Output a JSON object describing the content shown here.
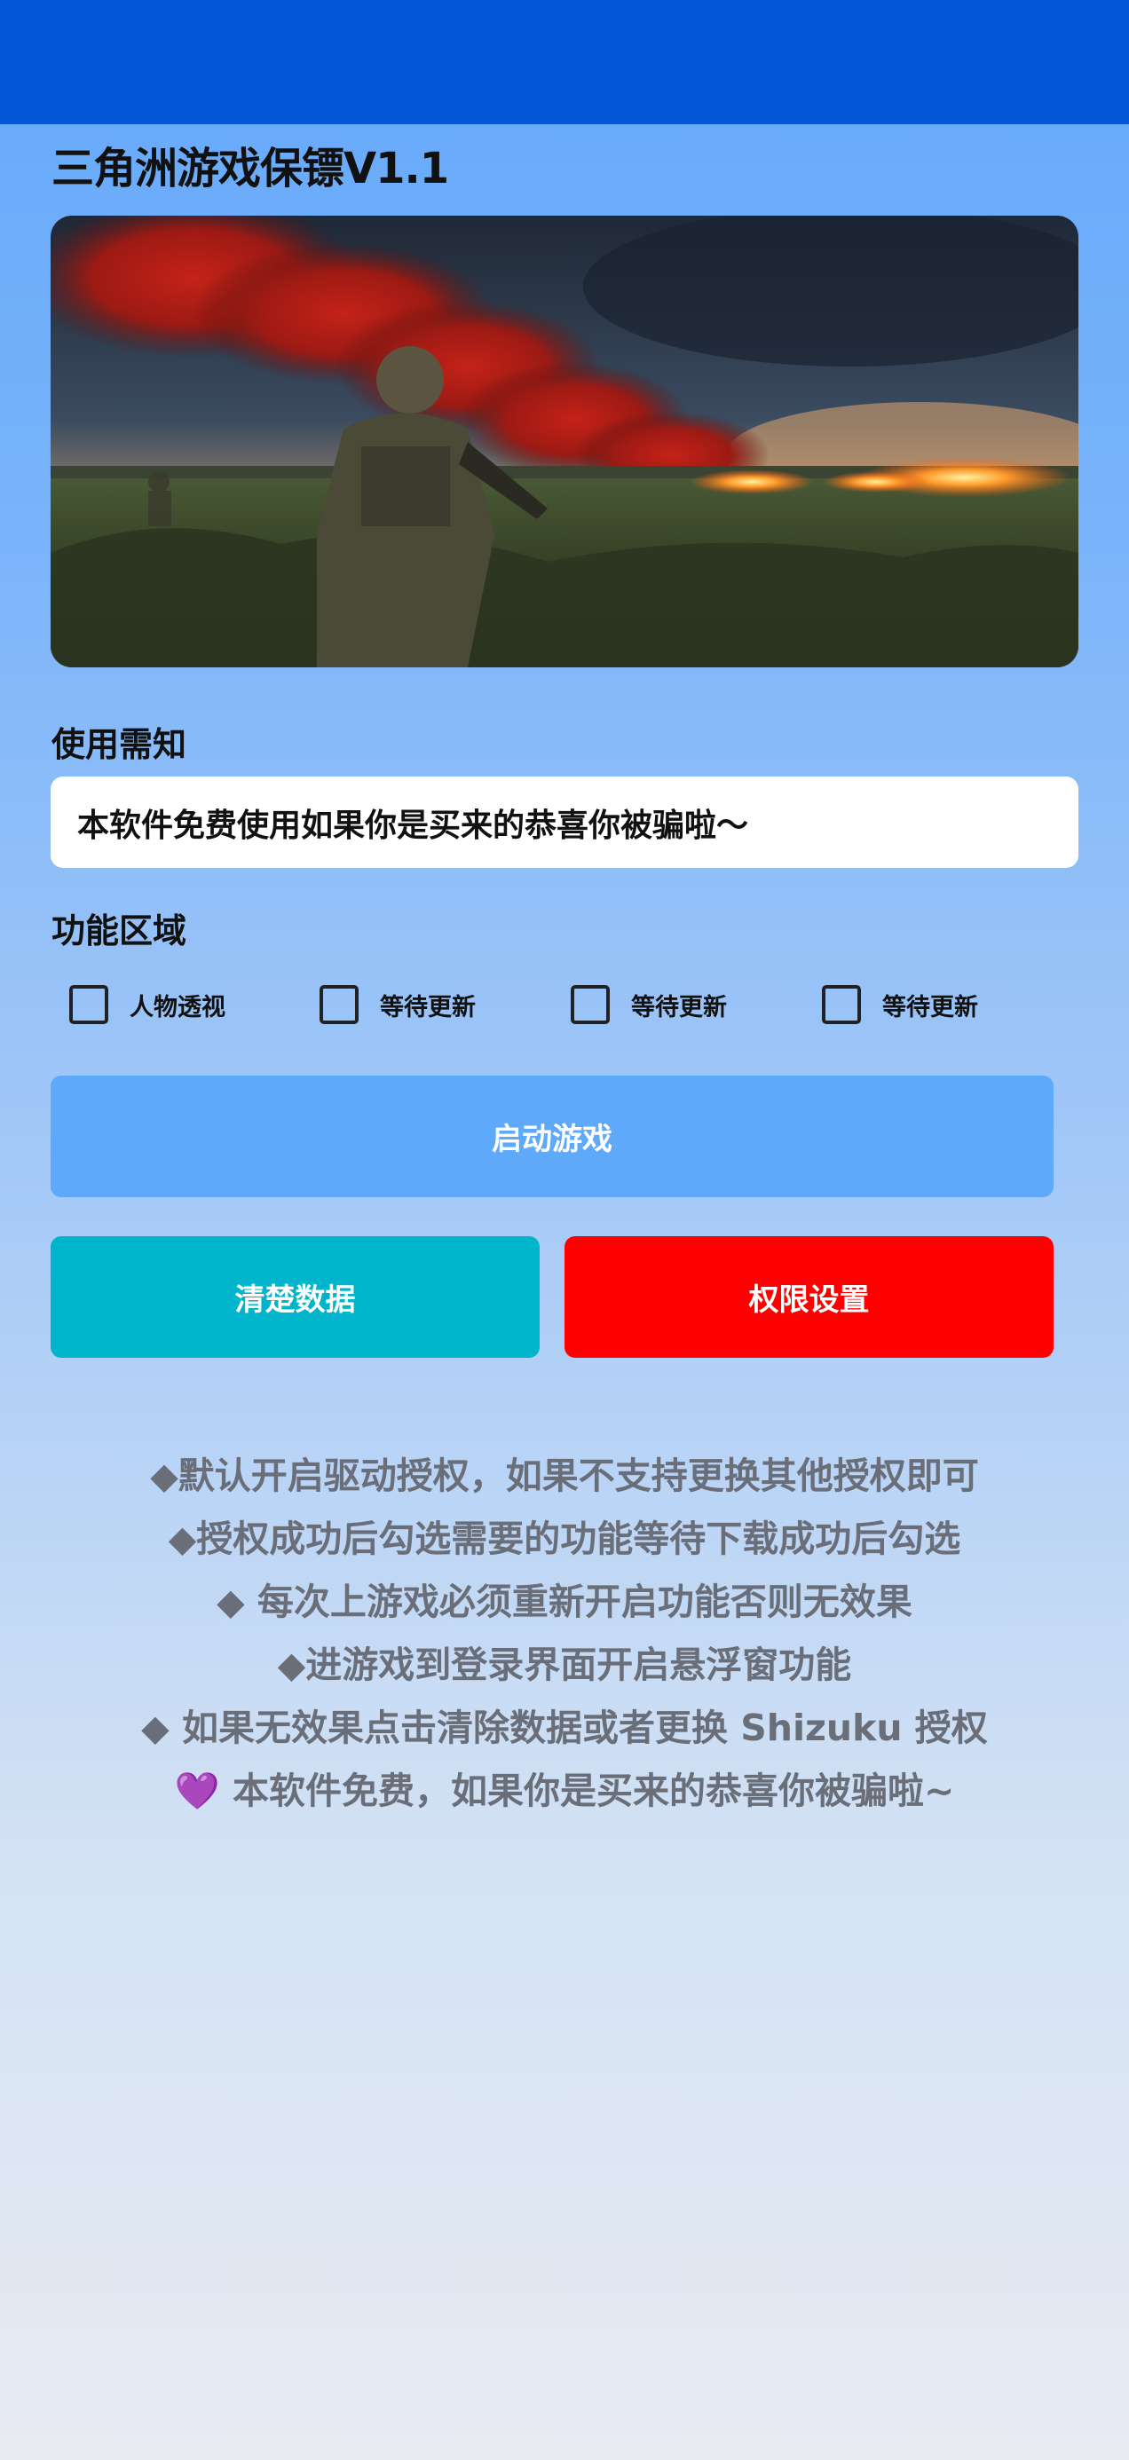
{
  "colors": {
    "status_bar": "#0356d6",
    "start_button": "#5fa9fb",
    "clear_button": "#00b4cc",
    "permission_button": "#fe0000",
    "note_text": "#6a6e78"
  },
  "header": {
    "title": "三角洲游戏保镖V1.1"
  },
  "banner": {
    "description_icon": "soldier-battlefield-image"
  },
  "notice": {
    "label": "使用需知",
    "text": "本软件免费使用如果你是买来的恭喜你被骗啦～"
  },
  "features": {
    "label": "功能区域",
    "options": [
      {
        "label": "人物透视",
        "checked": false
      },
      {
        "label": "等待更新",
        "checked": false
      },
      {
        "label": "等待更新",
        "checked": false
      },
      {
        "label": "等待更新",
        "checked": false
      }
    ]
  },
  "buttons": {
    "start": "启动游戏",
    "clear": "清楚数据",
    "permission": "权限设置"
  },
  "notes": [
    "◆默认开启驱动授权，如果不支持更换其他授权即可",
    "◆授权成功后勾选需要的功能等待下载成功后勾选",
    "◆ 每次上游戏必须重新开启功能否则无效果",
    "◆进游戏到登录界面开启悬浮窗功能",
    "◆ 如果无效果点击清除数据或者更换 Shizuku 授权",
    "💜 本软件免费，如果你是买来的恭喜你被骗啦~"
  ]
}
